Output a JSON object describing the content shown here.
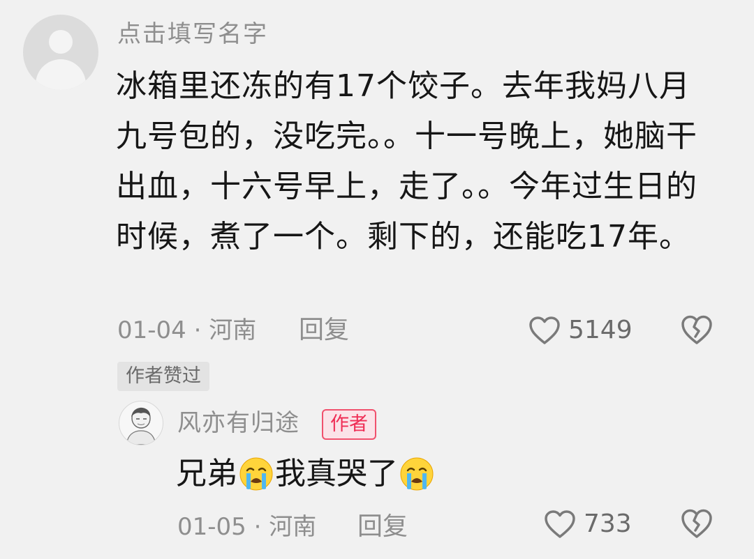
{
  "comment": {
    "username": "点击填写名字",
    "text": "冰箱里还冻的有17个饺子。去年我妈八月九号包的，没吃完。。十一号晚上，她脑干出血，十六号早上，走了。。今年过生日的时候，煮了一个。剩下的，还能吃17年。",
    "date_location": "01-04 · 河南",
    "reply_label": "回复",
    "likes": "5149",
    "author_liked_badge": "作者赞过"
  },
  "reply": {
    "username": "风亦有归途",
    "author_tag": "作者",
    "text_part1": "兄弟",
    "text_part2": "我真哭了",
    "date_location": "01-05 · 河南",
    "reply_label": "回复",
    "likes": "733"
  },
  "icons": {
    "like": "heart-outline-icon",
    "dislike": "broken-heart-icon",
    "emoji": "loudly-crying-face-emoji"
  },
  "colors": {
    "background": "#f1f1f1",
    "author_tag_text": "#ef2d55",
    "author_tag_border": "#f0516d",
    "meta_text": "#8e8e8e"
  }
}
